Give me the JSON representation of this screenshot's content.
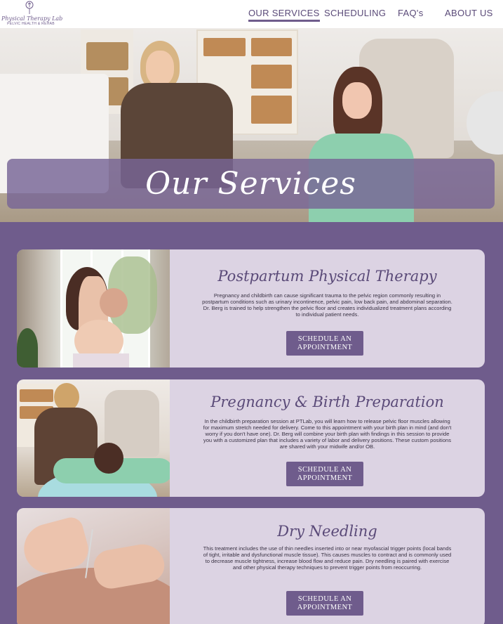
{
  "header": {
    "logo": {
      "name": "Physical Therapy Lab",
      "tagline": "PELVIC HEALTH & REHAB"
    },
    "nav": [
      {
        "label": "OUR SERVICES",
        "active": true
      },
      {
        "label": "SCHEDULING",
        "active": false
      },
      {
        "label": "FAQ's",
        "active": false
      },
      {
        "label": "ABOUT US",
        "active": false
      }
    ]
  },
  "hero": {
    "title": "Our Services"
  },
  "services": [
    {
      "title": "Postpartum Physical Therapy",
      "description": "Pregnancy and childbirth can cause significant trauma to the pelvic region commonly resulting in postpartum conditions such as urinary incontinence, pelvic pain, low back pain, and abdominal separation. Dr. Berg is trained to help strengthen the pelvic floor and creates individualized treatment plans according to individual patient needs.",
      "button": "SCHEDULE AN APPOINTMENT"
    },
    {
      "title": "Pregnancy & Birth Preparation",
      "description": "In the childbirth preparation session at PTLab, you will learn how to release pelvic floor muscles allowing for maximum stretch needed for delivery. Come to this appointment with your birth plan in mind (and don't worry if you don't have one). Dr. Berg will combine your birth plan with findings in this session to provide you with a customized plan that includes a variety of labor and delivery positions. These custom positions are shared with your midwife and/or OB.",
      "button": "SCHEDULE AN APPOINTMENT"
    },
    {
      "title": "Dry Needling",
      "description": "This treatment includes the use of thin needles inserted into or near myofascial trigger points (local bands of tight, irritable and dysfunctional muscle tissue). This causes muscles to contract and is commonly used to decrease muscle tightness, increase blood flow and reduce pain. Dry needling is paired with exercise and other physical therapy techniques to prevent trigger points from reoccurring.",
      "button": "SCHEDULE AN APPOINTMENT"
    }
  ],
  "colors": {
    "brand_purple": "#6f5c8c",
    "card_background": "#dcd3e3",
    "nav_text": "#5a4a78"
  }
}
